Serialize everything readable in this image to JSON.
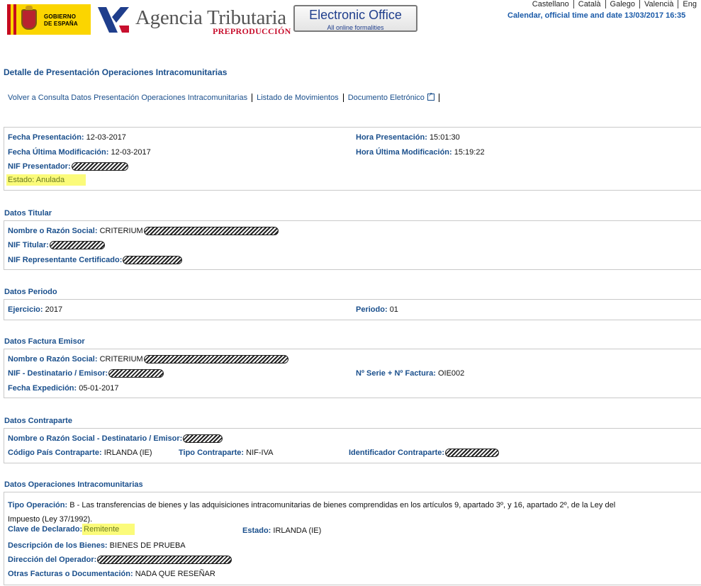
{
  "header": {
    "gobierno_line1": "GOBIERNO",
    "gobierno_line2": "DE ESPAÑA",
    "agency": "Agencia Tributaria",
    "environment": "PREPRODUCCIÓN",
    "eoffice_title": "Electronic Office",
    "eoffice_sub": "All online formalities",
    "languages": [
      "Castellano",
      "Català",
      "Galego",
      "Valencià",
      "Eng"
    ],
    "clock": "Calendar, official time and date 13/03/2017 16:35"
  },
  "page_title": "Detalle de Presentación Operaciones Intracomunitarias",
  "nav": {
    "back": "Volver a Consulta Datos Presentación Operaciones Intracomunitarias",
    "movements": "Listado de Movimientos",
    "document": "Documento Eletrónico"
  },
  "presentacion": {
    "fecha_label": "Fecha Presentación:",
    "fecha_value": "12-03-2017",
    "hora_label": "Hora Presentación:",
    "hora_value": "15:01:30",
    "fecha_mod_label": "Fecha Última Modificación:",
    "fecha_mod_value": "12-03-2017",
    "hora_mod_label": "Hora Última Modificación:",
    "hora_mod_value": "15:19:22",
    "nif_label": "NIF Presentador:",
    "estado_label": "Estado:",
    "estado_value": "Anulada"
  },
  "titular": {
    "title": "Datos Titular",
    "nombre_label": "Nombre o Razón Social:",
    "nombre_value": "CRITERIUM",
    "nif_label": "NIF Titular:",
    "nif_rep_label": "NIF Representante Certificado:"
  },
  "periodo": {
    "title": "Datos Periodo",
    "ejercicio_label": "Ejercicio:",
    "ejercicio_value": "2017",
    "periodo_label": "Periodo:",
    "periodo_value": "01"
  },
  "factura": {
    "title": "Datos Factura Emisor",
    "nombre_label": "Nombre o Razón Social:",
    "nombre_value": "CRITERIUM",
    "nif_label": "NIF - Destinatario / Emisor:",
    "serie_label": "Nº Serie + Nº Factura:",
    "serie_value": "OIE002",
    "fecha_label": "Fecha Expedición:",
    "fecha_value": "05-01-2017"
  },
  "contraparte": {
    "title": "Datos Contraparte",
    "nombre_label": "Nombre o Razón Social - Destinatario / Emisor:",
    "pais_label": "Código País Contraparte:",
    "pais_value": "IRLANDA (IE)",
    "tipo_label": "Tipo Contraparte:",
    "tipo_value": "NIF-IVA",
    "id_label": "Identificador Contraparte:"
  },
  "operaciones": {
    "title": "Datos Operaciones Intracomunitarias",
    "tipo_label": "Tipo Operación:",
    "tipo_value_line1": "B - Las transferencias de bienes y las adquisiciones intracomunitarias de bienes comprendidas en los artículos 9, apartado 3º, y 16, apartado 2º, de la Ley del",
    "tipo_value_line2": "Impuesto (Ley 37/1992).",
    "clave_label": "Clave de Declarado:",
    "clave_value": "Remitente",
    "estado_label": "Estado:",
    "estado_value": "IRLANDA (IE)",
    "desc_label": "Descripción de los Bienes:",
    "desc_value": "BIENES DE PRUEBA",
    "dir_label": "Dirección del Operador:",
    "otras_label": "Otras Facturas o Documentación:",
    "otras_value": "NADA QUE RESEÑAR"
  }
}
